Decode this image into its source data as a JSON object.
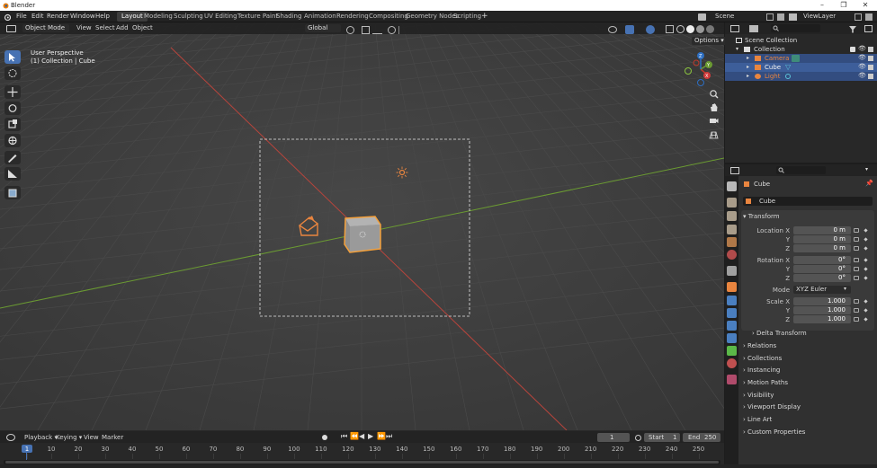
{
  "window": {
    "title": "Blender"
  },
  "menu": [
    "File",
    "Edit",
    "Render",
    "Window",
    "Help"
  ],
  "workspaces": [
    "Layout",
    "Modeling",
    "Sculpting",
    "UV Editing",
    "Texture Paint",
    "Shading",
    "Animation",
    "Rendering",
    "Compositing",
    "Geometry Nodes",
    "Scripting"
  ],
  "workspace_add": "+",
  "scene": {
    "label": "Scene",
    "view_layer": "ViewLayer"
  },
  "viewport": {
    "mode": "Object Mode",
    "menus": [
      "View",
      "Select",
      "Add",
      "Object"
    ],
    "transform_orientation": "Global",
    "options_label": "Options",
    "overlay_title": "User Perspective",
    "overlay_sub": "(1) Collection | Cube",
    "gizmo_axes": [
      "X",
      "Y",
      "Z"
    ]
  },
  "outliner": {
    "root": "Scene Collection",
    "collection": "Collection",
    "items": [
      {
        "name": "Camera",
        "color": "#e9853f",
        "selected": true
      },
      {
        "name": "Cube",
        "color": "#e6e6e6",
        "selected": true
      },
      {
        "name": "Light",
        "color": "#e9853f",
        "selected": true
      }
    ]
  },
  "properties": {
    "object_name": "Cube",
    "data_name": "Cube",
    "transform_label": "Transform",
    "location": {
      "label": "Location X",
      "x": "0 m",
      "y": "0 m",
      "z": "0 m"
    },
    "rotation": {
      "label": "Rotation X",
      "x": "0°",
      "y": "0°",
      "z": "0°"
    },
    "mode": {
      "label": "Mode",
      "value": "XYZ Euler"
    },
    "scale": {
      "label": "Scale X",
      "x": "1.000",
      "y": "1.000",
      "z": "1.000"
    },
    "axis_y": "Y",
    "axis_z": "Z",
    "delta": "Delta Transform",
    "sections": [
      "Relations",
      "Collections",
      "Instancing",
      "Motion Paths",
      "Visibility",
      "Viewport Display",
      "Line Art",
      "Custom Properties"
    ]
  },
  "timeline": {
    "menus": [
      "Playback",
      "Keying",
      "View",
      "Marker"
    ],
    "current_frame": "1",
    "start_label": "Start",
    "start": "1",
    "end_label": "End",
    "end": "250",
    "ticks": [
      "1",
      "10",
      "20",
      "30",
      "40",
      "50",
      "60",
      "70",
      "80",
      "90",
      "100",
      "110",
      "120",
      "130",
      "140",
      "150",
      "160",
      "170",
      "180",
      "190",
      "200",
      "210",
      "220",
      "230",
      "240",
      "250"
    ]
  },
  "colors": {
    "accent": "#4772b3",
    "selection": "#e9853f",
    "x_axis": "#c0392b",
    "y_axis": "#6b9b32"
  }
}
